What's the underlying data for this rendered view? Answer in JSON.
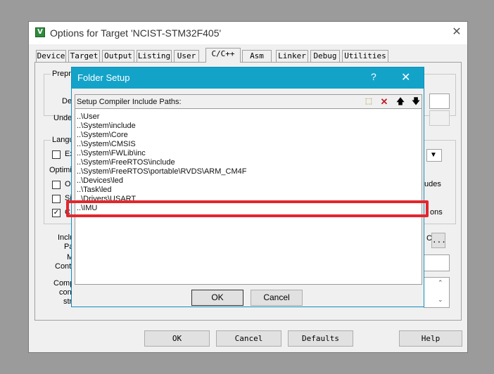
{
  "main": {
    "title": "Options for Target 'NCIST-STM32F405'",
    "app_icon": "V",
    "close_glyph": "✕",
    "tabs": [
      "Device",
      "Target",
      "Output",
      "Listing",
      "User",
      "C/C++",
      "Asm",
      "Linker",
      "Debug",
      "Utilities"
    ],
    "active_tab": "C/C++",
    "bg_labels": {
      "preprocessor": "Prepro",
      "define": "De",
      "undefine": "Unde",
      "language": "Langu",
      "execute_only": "Ex",
      "optimization": "Optimiz",
      "opt1": "Op",
      "opt2": "Si",
      "opt3": "C",
      "includes": "udes",
      "ons": "ons",
      "include_paths_1": "Inclu",
      "include_paths_2": "Pa",
      "misc_1": "M",
      "misc_2": "Contr",
      "compiler_1": "Comp",
      "compiler_2": "con",
      "compiler_3": "str",
      "ellipsis": "...",
      "c_marker": "C"
    },
    "buttons": {
      "ok": "OK",
      "cancel": "Cancel",
      "defaults": "Defaults",
      "help": "Help"
    }
  },
  "dialog": {
    "title": "Folder Setup",
    "help_glyph": "?",
    "close_glyph": "✕",
    "list_label": "Setup Compiler Include Paths:",
    "toolbar_icons": [
      "new-folder-icon",
      "delete-icon",
      "move-up-icon",
      "move-down-icon"
    ],
    "toolbar_glyphs": [
      "⬚",
      "✕",
      "🡅",
      "🡇"
    ],
    "paths": [
      "..\\User",
      "..\\System\\include",
      "..\\System\\Core",
      "..\\System\\CMSIS",
      "..\\System\\FWLib\\inc",
      "..\\System\\FreeRTOS\\include",
      "..\\System\\FreeRTOS\\portable\\RVDS\\ARM_CM4F",
      "..\\Devices\\led",
      "..\\Task\\led",
      "..\\Drivers\\USART",
      "..\\IMU"
    ],
    "highlighted_path": "..\\IMU",
    "buttons": {
      "ok": "OK",
      "cancel": "Cancel"
    }
  },
  "colors": {
    "dialog_title": "#13a3c9",
    "highlight": "#e4262c",
    "delete_icon": "#c0202a"
  }
}
